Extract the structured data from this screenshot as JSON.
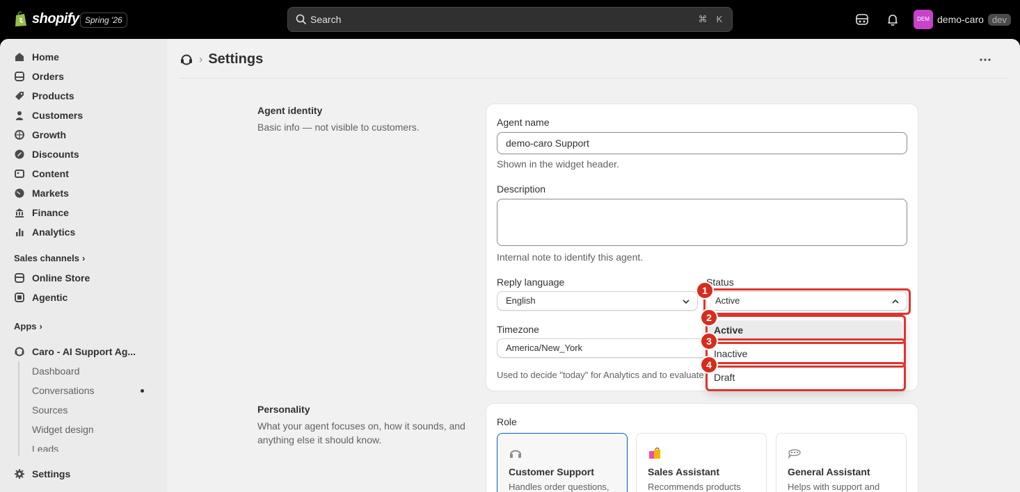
{
  "topbar": {
    "brand": "shopify",
    "edition": "Spring '26",
    "search_placeholder": "Search",
    "shortcut_cmd": "⌘",
    "shortcut_key": "K",
    "account_initials": "DEM",
    "account_name": "demo-caro",
    "account_badge": "dev"
  },
  "sidebar": {
    "items": [
      {
        "label": "Home",
        "icon": "home-icon"
      },
      {
        "label": "Orders",
        "icon": "orders-icon"
      },
      {
        "label": "Products",
        "icon": "tag-icon"
      },
      {
        "label": "Customers",
        "icon": "person-icon"
      },
      {
        "label": "Growth",
        "icon": "globe-arrow-icon"
      },
      {
        "label": "Discounts",
        "icon": "discount-icon"
      },
      {
        "label": "Content",
        "icon": "content-icon"
      },
      {
        "label": "Markets",
        "icon": "globe-icon"
      },
      {
        "label": "Finance",
        "icon": "bank-icon"
      },
      {
        "label": "Analytics",
        "icon": "chart-icon"
      }
    ],
    "sales_channels_label": "Sales channels",
    "channels": [
      {
        "label": "Online Store",
        "icon": "store-icon"
      },
      {
        "label": "Agentic",
        "icon": "agentic-icon"
      }
    ],
    "apps_label": "Apps",
    "app_name": "Caro - AI Support Ag...",
    "app_subitems": [
      "Dashboard",
      "Conversations",
      "Sources",
      "Widget design",
      "Leads"
    ],
    "settings_label": "Settings"
  },
  "page": {
    "title": "Settings"
  },
  "agent_identity": {
    "title": "Agent identity",
    "description": "Basic info — not visible to customers.",
    "agent_name_label": "Agent name",
    "agent_name_value": "demo-caro Support",
    "agent_name_help": "Shown in the widget header.",
    "description_label": "Description",
    "description_help": "Internal note to identify this agent.",
    "reply_language_label": "Reply language",
    "reply_language_value": "English",
    "status_label": "Status",
    "status_value": "Active",
    "status_options": [
      "Active",
      "Inactive",
      "Draft"
    ],
    "timezone_label": "Timezone",
    "timezone_value": "America/New_York",
    "timezone_help": "Used to decide \"today\" for Analytics and to evaluate"
  },
  "annotations": [
    "1",
    "2",
    "3",
    "4"
  ],
  "personality": {
    "title": "Personality",
    "description": "What your agent focuses on, how it sounds, and anything else it should know.",
    "role_label": "Role",
    "roles": [
      {
        "title": "Customer Support",
        "desc": "Handles order questions,",
        "icon": "headphones-icon"
      },
      {
        "title": "Sales Assistant",
        "desc": "Recommends products",
        "icon": "shopping-bags-icon"
      },
      {
        "title": "General Assistant",
        "desc": "Helps with support and",
        "icon": "speech-bubble-icon"
      }
    ]
  },
  "colors": {
    "topbar": "#000000",
    "sidebar": "#ebebeb",
    "main": "#f1f1f1",
    "highlight": "#e0332e",
    "badge": "#d72c1d",
    "avatar": "#c942c9",
    "selected_role_border": "#005bd3"
  }
}
